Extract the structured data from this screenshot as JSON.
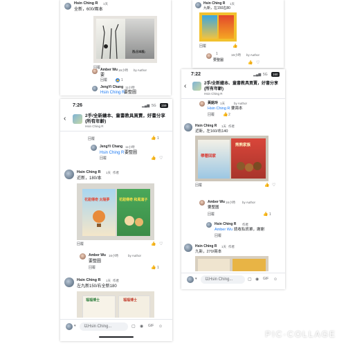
{
  "colors": {
    "brand_blue": "#1877f2",
    "muted_gray": "#65676b",
    "background": "#ffffff"
  },
  "top_left": {
    "comment_name": "Hsin Ching R",
    "comment_meta": "1天",
    "comment_text": "全新，600/兩本",
    "book_title": "西(日本版)",
    "reply_name": "Amber Wu",
    "reply_meta": "16小時",
    "reply_author": "by Author",
    "reply_text": "要",
    "reply_label": "回覆",
    "reply_count": "1",
    "third_name": "JengYi Chang",
    "third_meta": "11小時",
    "third_link": "Hsin Ching R",
    "third_text": "要整圖"
  },
  "top_right": {
    "comment_name": "Hsin Ching R",
    "comment_meta": "1天",
    "comment_text": "九新，左150右80",
    "reply_label": "回覆",
    "like_count": "1",
    "author_meta": "16小時",
    "author_tag": "by Author",
    "author_text": "要整圖"
  },
  "left_phone": {
    "time": "7:26",
    "signal": "5G",
    "battery": "159",
    "group_title": "2手/全新繪本、童書教具買賣，好書分享 (所有年齡)",
    "group_sub": "Hsin Ching R",
    "first_reply_label": "回覆",
    "first_like_count": "1",
    "jy_name": "JengYi Chang",
    "jy_meta": "11小時",
    "jy_link": "Hsin Ching R",
    "jy_text": "要整圖",
    "jy_reply": "回覆",
    "post1_name": "Hsin Ching R",
    "post1_meta": "1天",
    "post1_author": "作者",
    "post1_text": "近新，180/本",
    "book1_title": "花甜傳奇 太陽夢",
    "book2_title": "花甜傳奇 和風瀉子",
    "post1_reply": "回覆",
    "amber_name": "Amber Wu",
    "amber_meta": "16小時",
    "amber_author": "by Author",
    "amber_text": "要整圖",
    "amber_reply": "回覆",
    "amber_count": "1",
    "post2_name": "Hsin Ching R",
    "post2_meta": "1天",
    "post2_author": "作者",
    "post2_text": "左九新150/右全新180",
    "book3_title": "福福博士",
    "book4_title": "福福博士",
    "composer_placeholder": "以Hsin Ching..."
  },
  "right_phone": {
    "time": "7:22",
    "signal": "5G",
    "battery": "160",
    "group_title": "2手/全新繪本、童書教具買賣，好書分享 (所有年齡)",
    "group_sub": "Hsin Ching R",
    "huang_name": "黃銘玲",
    "huang_meta": "1天",
    "huang_author": "by Author",
    "huang_link": "Hsin Ching R",
    "huang_text": "要兩本",
    "huang_reply": "回覆",
    "huang_count": "2",
    "post1_name": "Hsin Ching R",
    "post1_meta": "1天",
    "post1_author": "作者",
    "post1_text": "近新，左160/右140",
    "book1_title": "帶著回家",
    "book2_title": "熊熊家族",
    "post1_reply": "回覆",
    "amber_name": "Amber Wu",
    "amber_meta": "16小時",
    "amber_author": "by Author",
    "amber_text": "要整圖",
    "amber_reply": "回覆",
    "amber_count": "1",
    "hc_name": "Hsin Ching R",
    "hc_meta": "作者",
    "hc_link": "Amber Wu",
    "hc_text": "請收私訊單，謝謝",
    "hc_reply": "回覆",
    "post2_name": "Hsin Ching R",
    "post2_meta": "1天",
    "post2_author": "作者",
    "post2_text": "九新，270/兩本",
    "composer_placeholder": "以Hsin Ching..."
  },
  "watermark": "PIC·COLLAGE"
}
